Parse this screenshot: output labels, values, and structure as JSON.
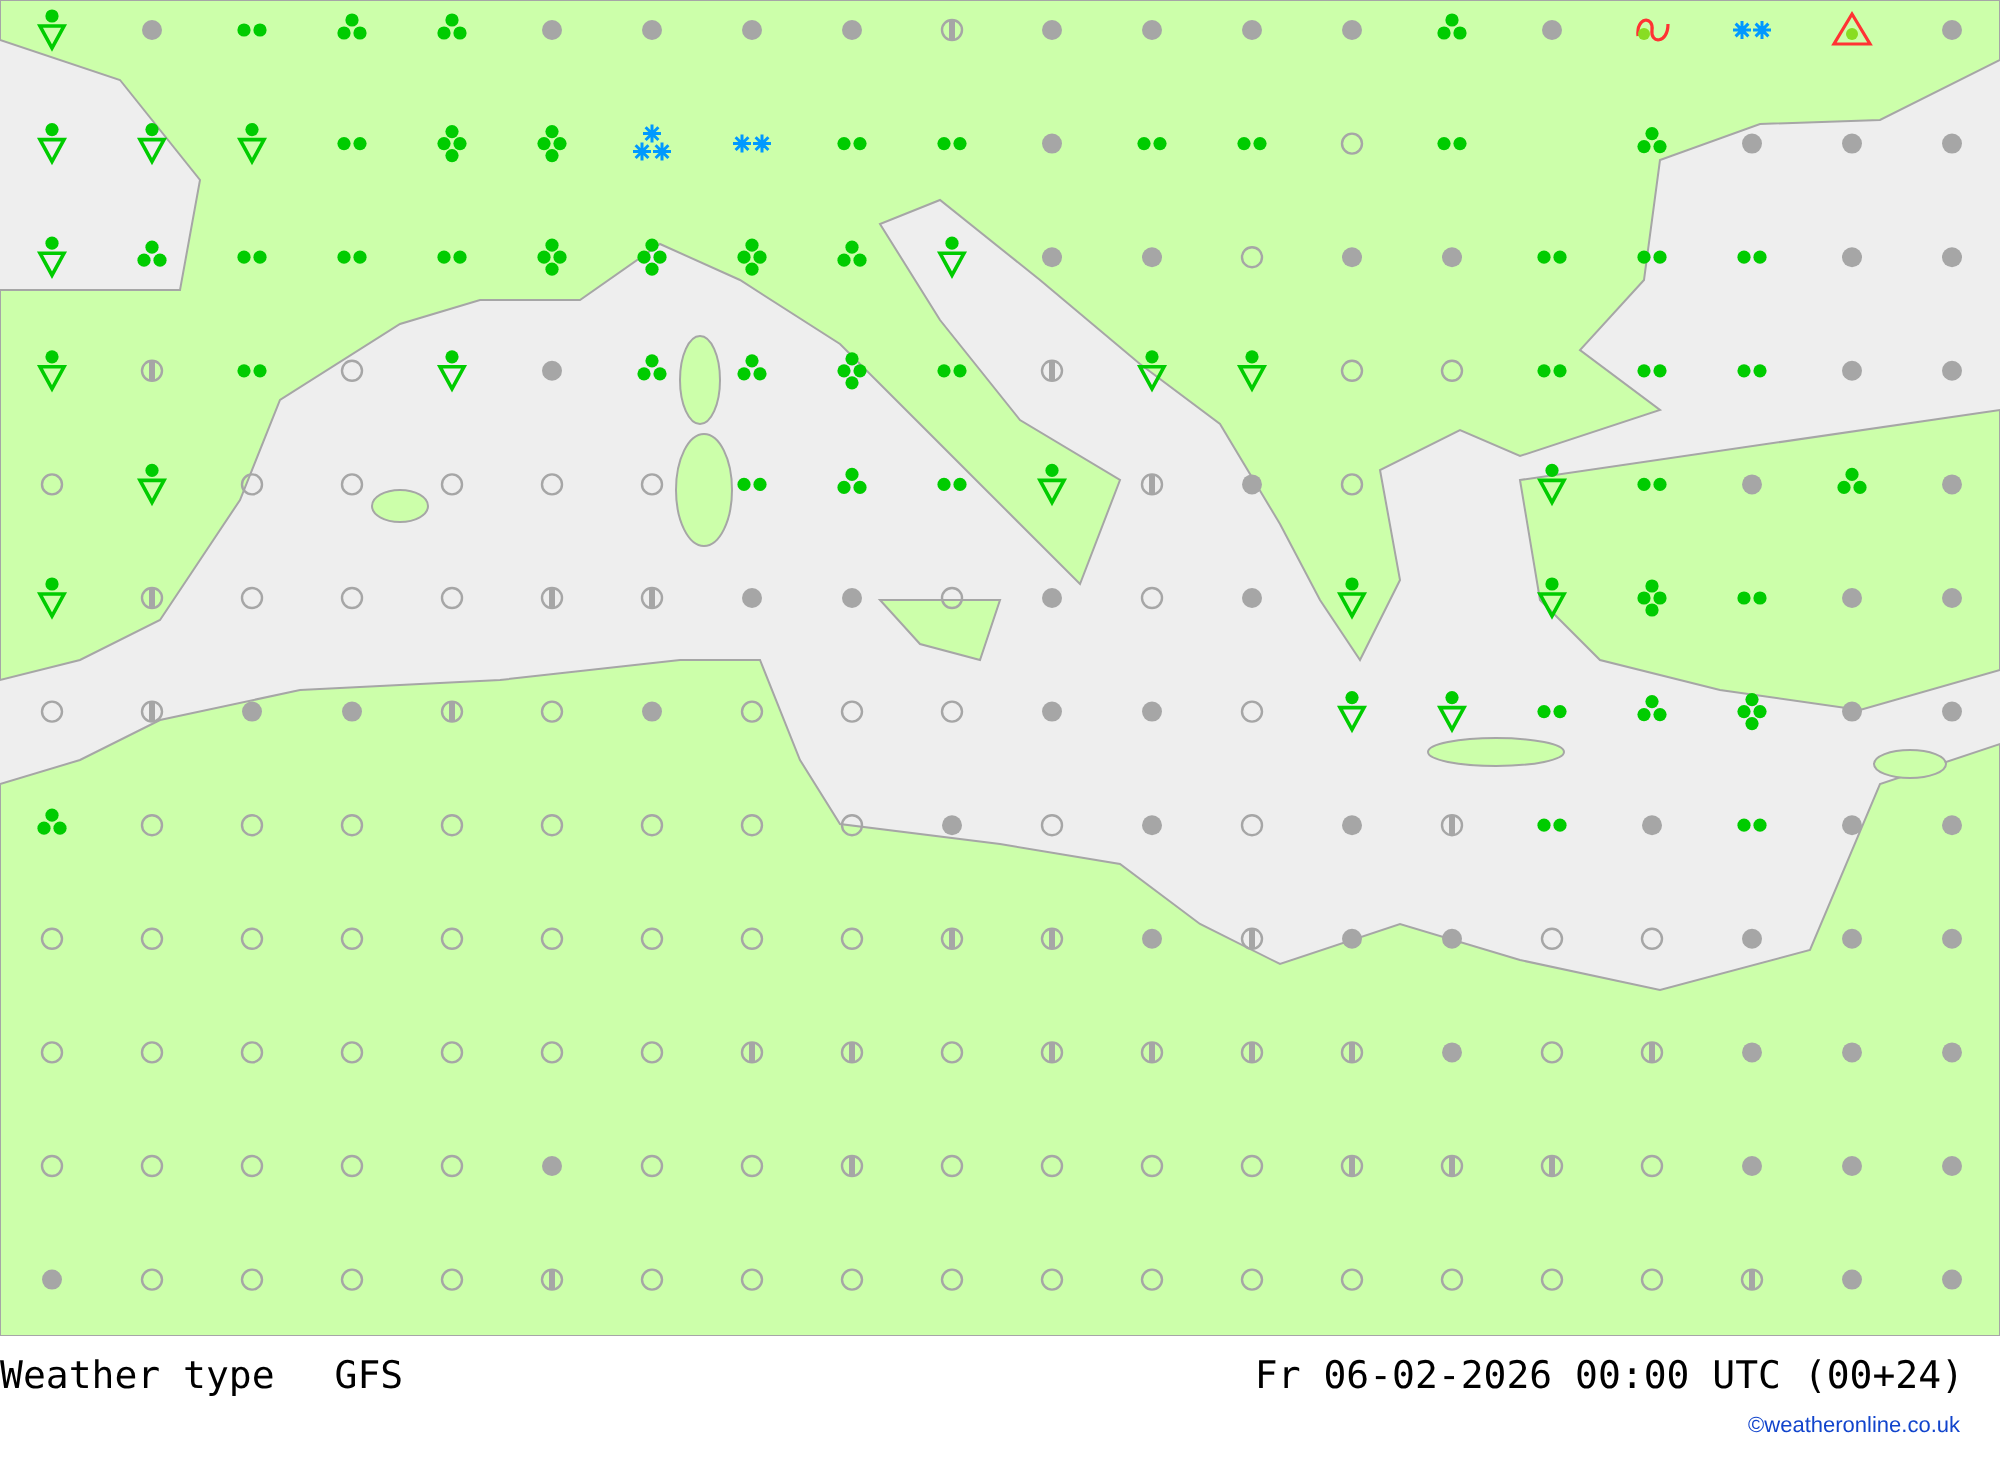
{
  "map": {
    "rows": [
      [
        {
          "kind": "shower"
        },
        {
          "kind": "overcast"
        },
        {
          "kind": "drizzle"
        },
        {
          "kind": "rain"
        },
        {
          "kind": "rain"
        },
        {
          "kind": "overcast"
        },
        {
          "kind": "overcast"
        },
        {
          "kind": "overcast"
        },
        {
          "kind": "overcast"
        },
        {
          "kind": "partly"
        },
        {
          "kind": "overcast"
        },
        {
          "kind": "overcast"
        },
        {
          "kind": "overcast"
        },
        {
          "kind": "overcast"
        },
        {
          "kind": "rain"
        },
        {
          "kind": "overcast"
        },
        {
          "kind": "freezing"
        },
        {
          "kind": "snowlight"
        },
        {
          "kind": "thunder"
        },
        {
          "kind": "overcast"
        }
      ],
      [
        {
          "kind": "shower"
        },
        {
          "kind": "shower"
        },
        {
          "kind": "shower"
        },
        {
          "kind": "drizzle"
        },
        {
          "kind": "heavyrain"
        },
        {
          "kind": "heavyrain"
        },
        {
          "kind": "snow"
        },
        {
          "kind": "snowlight"
        },
        {
          "kind": "drizzle"
        },
        {
          "kind": "drizzle"
        },
        {
          "kind": "overcast"
        },
        {
          "kind": "drizzle"
        },
        {
          "kind": "drizzle"
        },
        {
          "kind": "clear"
        },
        {
          "kind": "drizzle"
        },
        null,
        {
          "kind": "rain"
        },
        {
          "kind": "overcast"
        },
        {
          "kind": "overcast"
        },
        {
          "kind": "overcast"
        }
      ],
      [
        {
          "kind": "shower"
        },
        {
          "kind": "rain"
        },
        {
          "kind": "drizzle"
        },
        {
          "kind": "drizzle"
        },
        {
          "kind": "drizzle"
        },
        {
          "kind": "heavyrain"
        },
        {
          "kind": "heavyrain"
        },
        {
          "kind": "heavyrain"
        },
        {
          "kind": "rain"
        },
        {
          "kind": "shower"
        },
        {
          "kind": "overcast"
        },
        {
          "kind": "overcast"
        },
        {
          "kind": "clear"
        },
        {
          "kind": "overcast"
        },
        {
          "kind": "overcast"
        },
        {
          "kind": "drizzle"
        },
        {
          "kind": "drizzle"
        },
        {
          "kind": "drizzle"
        },
        {
          "kind": "overcast"
        },
        {
          "kind": "overcast"
        }
      ],
      [
        {
          "kind": "shower"
        },
        {
          "kind": "partly"
        },
        {
          "kind": "drizzle"
        },
        {
          "kind": "clear"
        },
        {
          "kind": "shower"
        },
        {
          "kind": "overcast"
        },
        {
          "kind": "rain"
        },
        {
          "kind": "rain"
        },
        {
          "kind": "heavyrain"
        },
        {
          "kind": "drizzle"
        },
        {
          "kind": "partly"
        },
        {
          "kind": "shower"
        },
        {
          "kind": "shower"
        },
        {
          "kind": "clear"
        },
        {
          "kind": "clear"
        },
        {
          "kind": "drizzle"
        },
        {
          "kind": "drizzle"
        },
        {
          "kind": "drizzle"
        },
        {
          "kind": "overcast"
        },
        {
          "kind": "overcast"
        }
      ],
      [
        {
          "kind": "clear"
        },
        {
          "kind": "shower"
        },
        {
          "kind": "clear"
        },
        {
          "kind": "clear"
        },
        {
          "kind": "clear"
        },
        {
          "kind": "clear"
        },
        {
          "kind": "clear"
        },
        {
          "kind": "drizzle"
        },
        {
          "kind": "rain"
        },
        {
          "kind": "drizzle"
        },
        {
          "kind": "shower"
        },
        {
          "kind": "partly"
        },
        {
          "kind": "overcast"
        },
        {
          "kind": "clear"
        },
        null,
        {
          "kind": "shower"
        },
        {
          "kind": "drizzle"
        },
        {
          "kind": "overcast"
        },
        {
          "kind": "rain"
        },
        {
          "kind": "overcast"
        }
      ],
      [
        {
          "kind": "shower"
        },
        {
          "kind": "partly"
        },
        {
          "kind": "clear"
        },
        {
          "kind": "clear"
        },
        {
          "kind": "clear"
        },
        {
          "kind": "partly"
        },
        {
          "kind": "partly"
        },
        {
          "kind": "overcast"
        },
        {
          "kind": "overcast"
        },
        {
          "kind": "clear"
        },
        {
          "kind": "overcast"
        },
        {
          "kind": "clear"
        },
        {
          "kind": "overcast"
        },
        {
          "kind": "shower"
        },
        null,
        {
          "kind": "shower"
        },
        {
          "kind": "heavyrain"
        },
        {
          "kind": "drizzle"
        },
        {
          "kind": "overcast"
        },
        {
          "kind": "overcast"
        }
      ],
      [
        {
          "kind": "clear"
        },
        {
          "kind": "partly"
        },
        {
          "kind": "overcast"
        },
        {
          "kind": "overcast"
        },
        {
          "kind": "partly"
        },
        {
          "kind": "clear"
        },
        {
          "kind": "overcast"
        },
        {
          "kind": "clear"
        },
        {
          "kind": "clear"
        },
        {
          "kind": "clear"
        },
        {
          "kind": "overcast"
        },
        {
          "kind": "overcast"
        },
        {
          "kind": "clear"
        },
        {
          "kind": "shower"
        },
        {
          "kind": "shower"
        },
        {
          "kind": "drizzle"
        },
        {
          "kind": "rain"
        },
        {
          "kind": "heavyrain"
        },
        {
          "kind": "overcast"
        },
        {
          "kind": "overcast"
        }
      ],
      [
        {
          "kind": "rain"
        },
        {
          "kind": "clear"
        },
        {
          "kind": "clear"
        },
        {
          "kind": "clear"
        },
        {
          "kind": "clear"
        },
        {
          "kind": "clear"
        },
        {
          "kind": "clear"
        },
        {
          "kind": "clear"
        },
        {
          "kind": "clear"
        },
        {
          "kind": "overcast"
        },
        {
          "kind": "clear"
        },
        {
          "kind": "overcast"
        },
        {
          "kind": "clear"
        },
        {
          "kind": "overcast"
        },
        {
          "kind": "partly"
        },
        {
          "kind": "drizzle"
        },
        {
          "kind": "overcast"
        },
        {
          "kind": "drizzle"
        },
        {
          "kind": "overcast"
        },
        {
          "kind": "overcast"
        }
      ],
      [
        {
          "kind": "clear"
        },
        {
          "kind": "clear"
        },
        {
          "kind": "clear"
        },
        {
          "kind": "clear"
        },
        {
          "kind": "clear"
        },
        {
          "kind": "clear"
        },
        {
          "kind": "clear"
        },
        {
          "kind": "clear"
        },
        {
          "kind": "clear"
        },
        {
          "kind": "partly"
        },
        {
          "kind": "partly"
        },
        {
          "kind": "overcast"
        },
        {
          "kind": "partly"
        },
        {
          "kind": "overcast"
        },
        {
          "kind": "overcast"
        },
        {
          "kind": "clear"
        },
        {
          "kind": "clear"
        },
        {
          "kind": "overcast"
        },
        {
          "kind": "overcast"
        },
        {
          "kind": "overcast"
        }
      ],
      [
        {
          "kind": "clear"
        },
        {
          "kind": "clear"
        },
        {
          "kind": "clear"
        },
        {
          "kind": "clear"
        },
        {
          "kind": "clear"
        },
        {
          "kind": "clear"
        },
        {
          "kind": "clear"
        },
        {
          "kind": "partly"
        },
        {
          "kind": "partly"
        },
        {
          "kind": "clear"
        },
        {
          "kind": "partly"
        },
        {
          "kind": "partly"
        },
        {
          "kind": "partly"
        },
        {
          "kind": "partly"
        },
        {
          "kind": "overcast"
        },
        {
          "kind": "clear"
        },
        {
          "kind": "partly"
        },
        {
          "kind": "overcast"
        },
        {
          "kind": "overcast"
        },
        {
          "kind": "overcast"
        }
      ],
      [
        {
          "kind": "clear"
        },
        {
          "kind": "clear"
        },
        {
          "kind": "clear"
        },
        {
          "kind": "clear"
        },
        {
          "kind": "clear"
        },
        {
          "kind": "overcast"
        },
        {
          "kind": "clear"
        },
        {
          "kind": "clear"
        },
        {
          "kind": "partly"
        },
        {
          "kind": "clear"
        },
        {
          "kind": "clear"
        },
        {
          "kind": "clear"
        },
        {
          "kind": "clear"
        },
        {
          "kind": "partly"
        },
        {
          "kind": "partly"
        },
        {
          "kind": "partly"
        },
        {
          "kind": "clear"
        },
        {
          "kind": "overcast"
        },
        {
          "kind": "overcast"
        },
        {
          "kind": "overcast"
        }
      ],
      [
        {
          "kind": "overcast"
        },
        {
          "kind": "clear"
        },
        {
          "kind": "clear"
        },
        {
          "kind": "clear"
        },
        {
          "kind": "clear"
        },
        {
          "kind": "partly"
        },
        {
          "kind": "clear"
        },
        {
          "kind": "clear"
        },
        {
          "kind": "clear"
        },
        {
          "kind": "clear"
        },
        {
          "kind": "clear"
        },
        {
          "kind": "clear"
        },
        {
          "kind": "clear"
        },
        {
          "kind": "clear"
        },
        {
          "kind": "clear"
        },
        {
          "kind": "clear"
        },
        {
          "kind": "clear"
        },
        {
          "kind": "partly"
        },
        {
          "kind": "overcast"
        },
        {
          "kind": "overcast"
        }
      ]
    ]
  },
  "footer": {
    "title": "Weather type",
    "model": "GFS",
    "valid_time": "Fr 06-02-2026 00:00 UTC (00+24)",
    "credit": "©weatheronline.co.uk"
  }
}
